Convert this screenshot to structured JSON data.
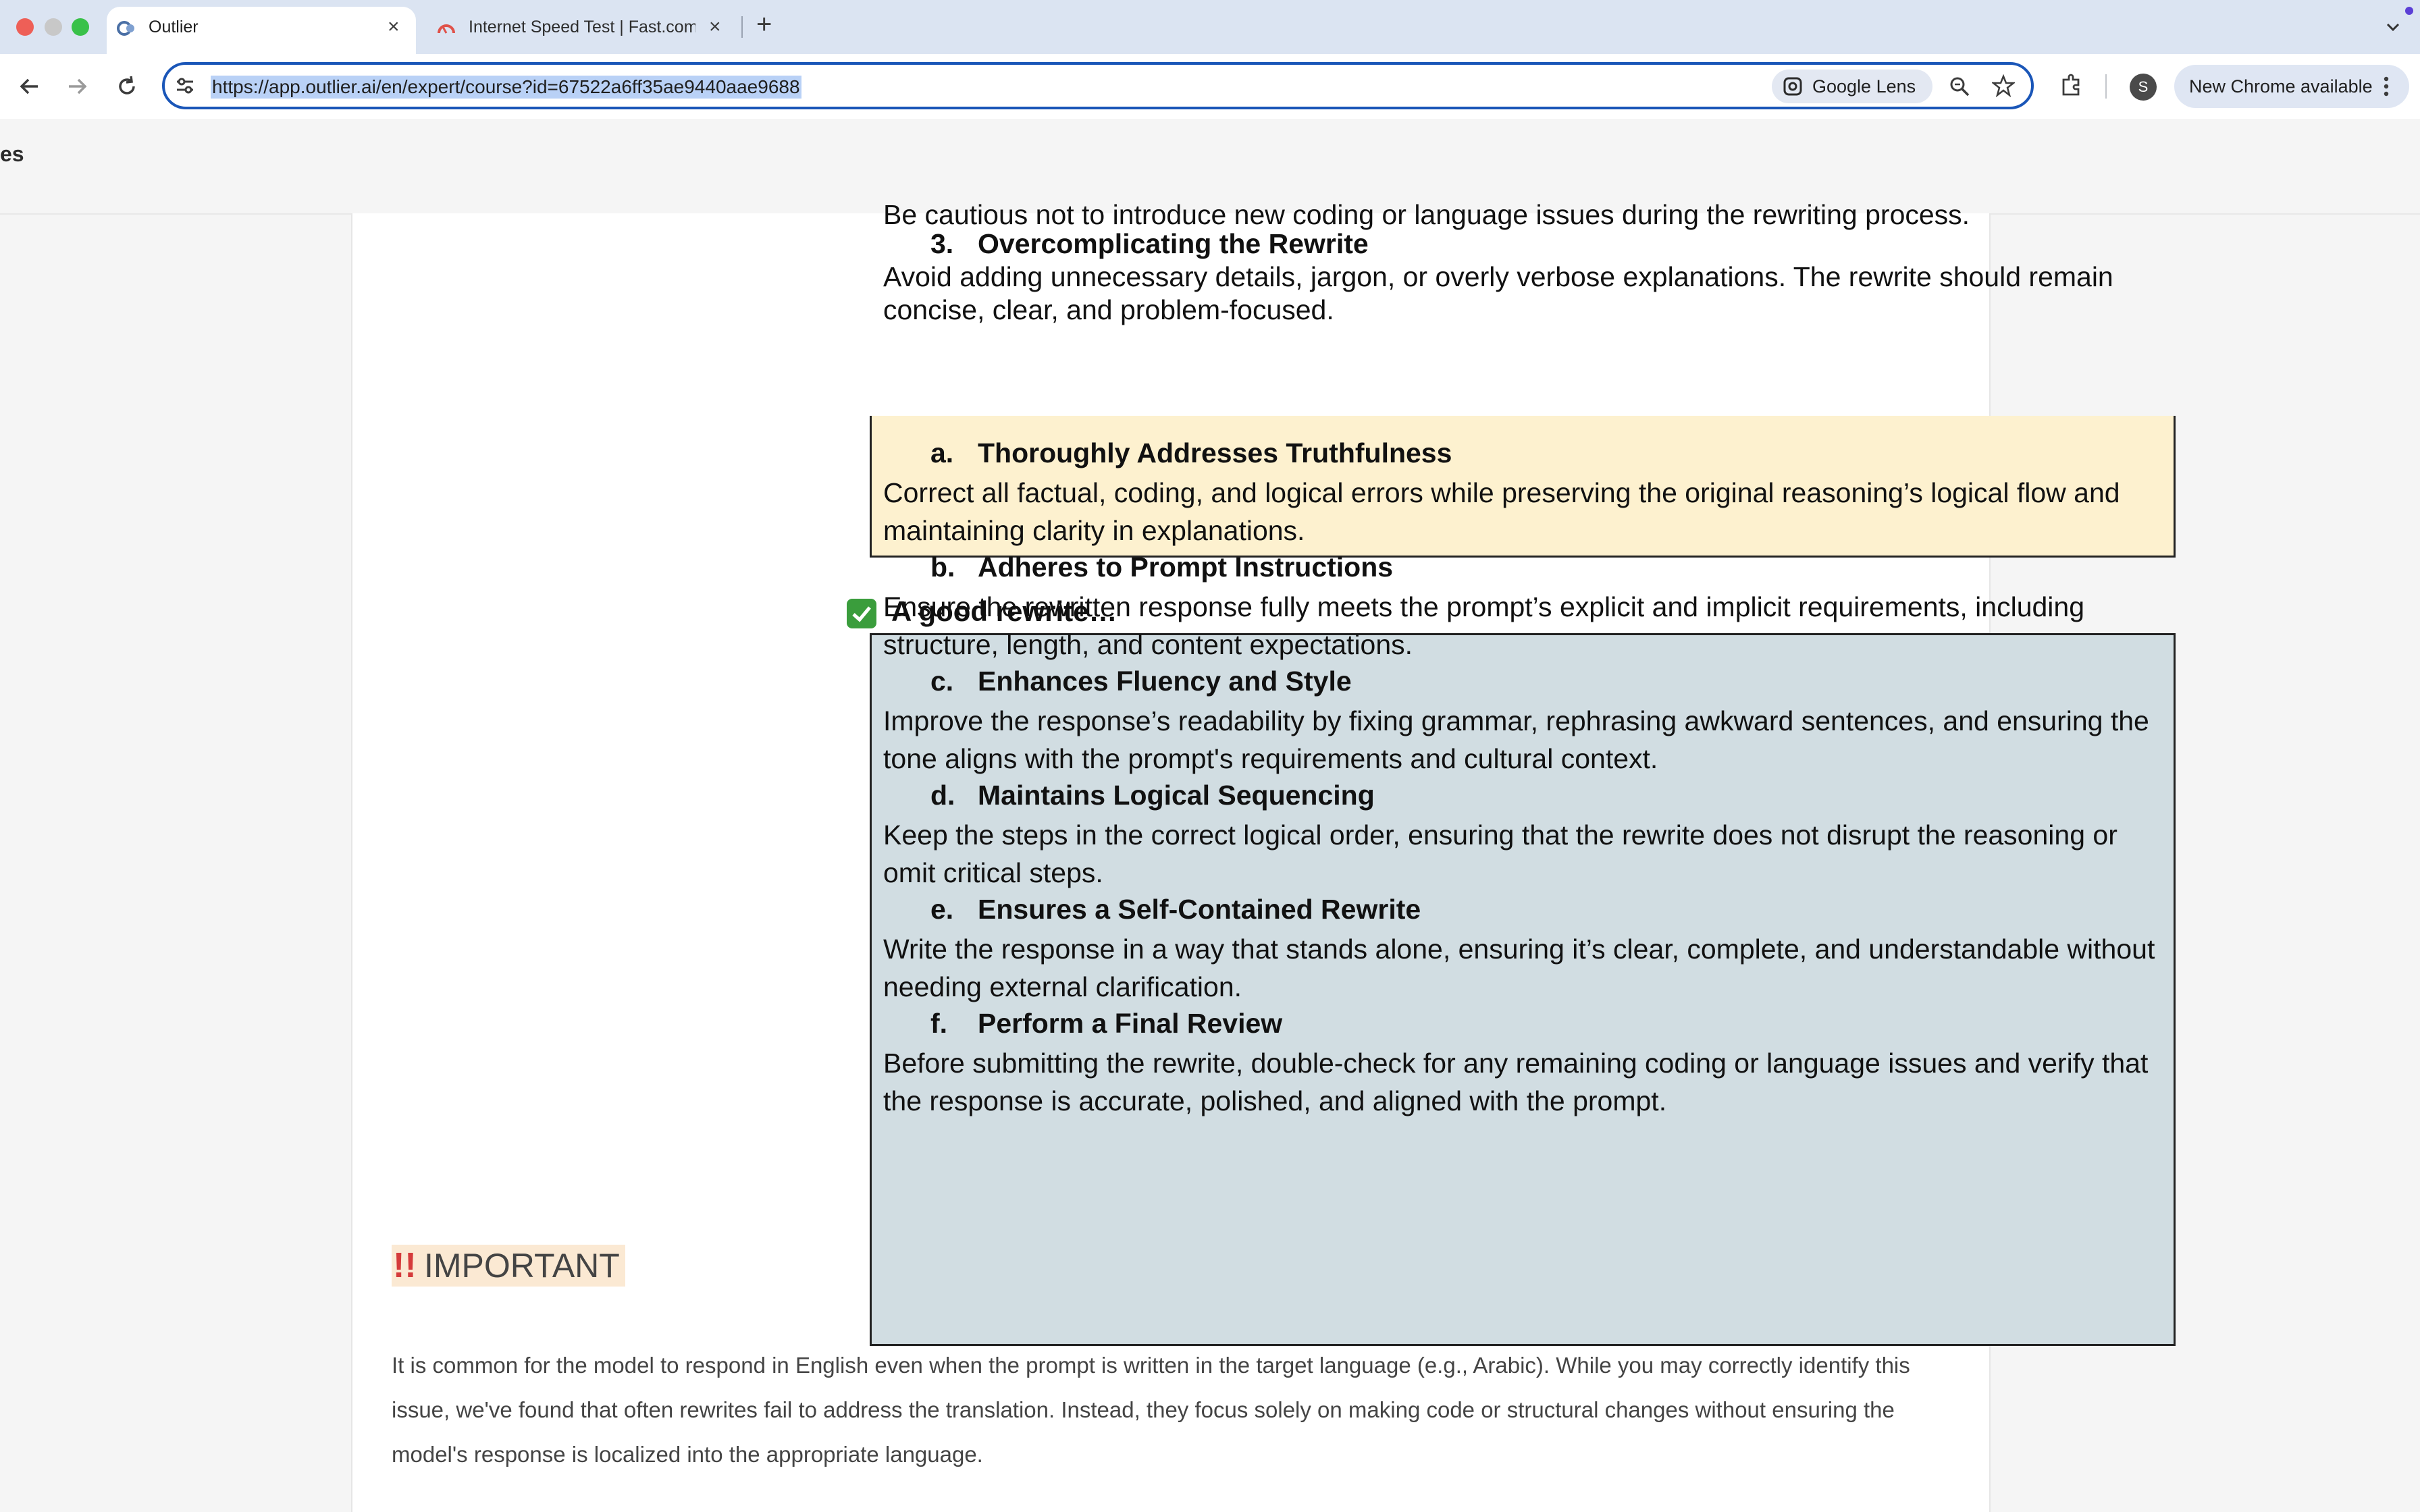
{
  "browser": {
    "tabs": [
      {
        "title": "Outlier",
        "active": true
      },
      {
        "title": "Internet Speed Test | Fast.com",
        "active": false
      }
    ],
    "url": "https://app.outlier.ai/en/expert/course?id=67522a6ff35ae9440aae9688",
    "google_lens_label": "Google Lens",
    "profile_initial": "S",
    "new_chrome_label": "New Chrome available"
  },
  "app_header": {
    "partial_title": "es"
  },
  "doc": {
    "yellow_box": {
      "cut_line": "Be cautious not to introduce new coding or language issues during the rewriting process.",
      "item3_num": "3.",
      "item3_title": "Overcomplicating the Rewrite",
      "item3_body": "Avoid adding unnecessary details, jargon, or overly verbose explanations. The rewrite should remain concise, clear, and problem-focused."
    },
    "good_rewrite_title": "A good rewrite…",
    "items": [
      {
        "letter": "a.",
        "title": "Thoroughly Addresses Truthfulness",
        "body": "Correct all factual, coding, and logical errors while preserving the original reasoning’s logical flow and maintaining clarity in explanations."
      },
      {
        "letter": "b.",
        "title": "Adheres to Prompt Instructions",
        "body": "Ensure the rewritten response fully meets the prompt’s explicit and implicit requirements, including structure, length, and content expectations."
      },
      {
        "letter": "c.",
        "title": "Enhances Fluency and Style",
        "body": "Improve the response’s readability by fixing grammar, rephrasing awkward sentences, and ensuring the tone aligns with the prompt's requirements and cultural context."
      },
      {
        "letter": "d.",
        "title": "Maintains Logical Sequencing",
        "body": "Keep the steps in the correct logical order, ensuring that the rewrite does not disrupt the reasoning or omit critical steps."
      },
      {
        "letter": "e.",
        "title": "Ensures a Self-Contained Rewrite",
        "body": "Write the response in a way that stands alone, ensuring it’s clear, complete, and understandable without needing external clarification."
      },
      {
        "letter": "f.",
        "title": "Perform a Final Review",
        "body": "Before submitting the rewrite, double-check for any remaining coding or language issues and verify that the response is accurate, polished, and aligned with the prompt."
      }
    ]
  },
  "important": {
    "marks": "!!",
    "heading": "IMPORTANT",
    "paragraph": "It is common for the model to respond in English even when the prompt is written in the target language (e.g., Arabic). While you may correctly identify this issue, we've found that often rewrites fail to address the translation. Instead, they focus solely on making code or structural changes without ensuring the model's response is localized into the appropriate language."
  }
}
